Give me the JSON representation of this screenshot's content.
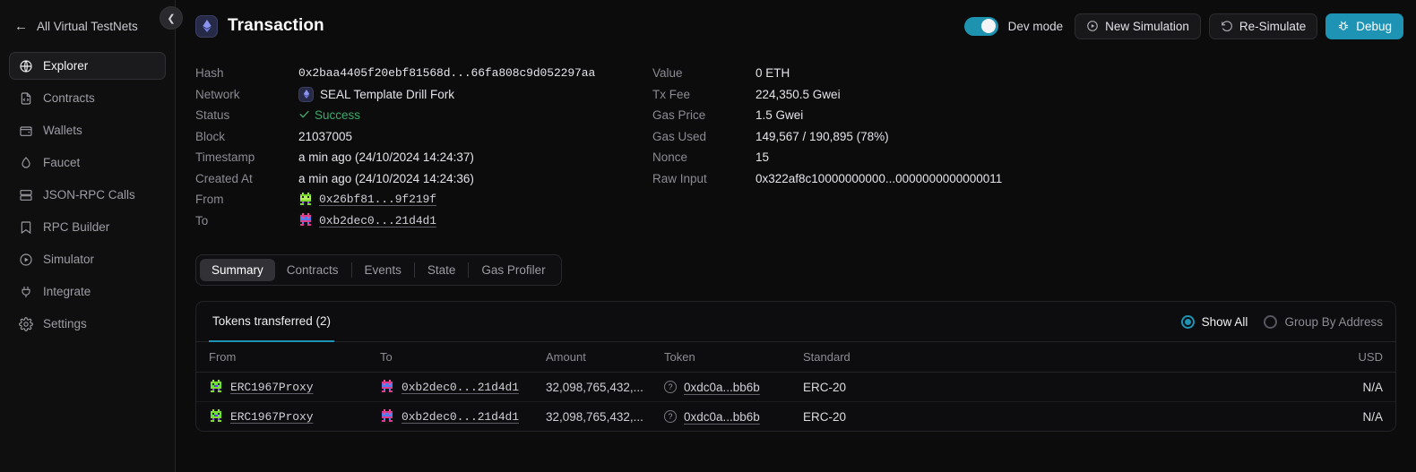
{
  "sidebar": {
    "back_label": "All Virtual TestNets",
    "collapse_icon": "chevron-left-icon",
    "items": [
      {
        "label": "Explorer",
        "icon": "globe-icon",
        "active": true
      },
      {
        "label": "Contracts",
        "icon": "file-code-icon",
        "active": false
      },
      {
        "label": "Wallets",
        "icon": "wallet-icon",
        "active": false
      },
      {
        "label": "Faucet",
        "icon": "droplet-icon",
        "active": false
      },
      {
        "label": "JSON-RPC Calls",
        "icon": "server-icon",
        "active": false
      },
      {
        "label": "RPC Builder",
        "icon": "bookmark-icon",
        "active": false
      },
      {
        "label": "Simulator",
        "icon": "play-circle-icon",
        "active": false
      },
      {
        "label": "Integrate",
        "icon": "plug-icon",
        "active": false
      },
      {
        "label": "Settings",
        "icon": "gear-icon",
        "active": false
      }
    ]
  },
  "header": {
    "title": "Transaction",
    "badge_icon": "ethereum-icon",
    "dev_mode_label": "Dev mode",
    "dev_mode_on": true,
    "new_simulation_label": "New Simulation",
    "new_simulation_icon": "play-circle-icon",
    "resimulate_label": "Re-Simulate",
    "resimulate_icon": "rotate-ccw-icon",
    "debug_label": "Debug",
    "debug_icon": "bug-icon"
  },
  "details": {
    "left": [
      {
        "label": "Hash",
        "value": "0x2baa4405f20ebf81568d...66fa808c9d052297aa",
        "kind": "mono"
      },
      {
        "label": "Network",
        "value": "SEAL Template Drill Fork",
        "kind": "network"
      },
      {
        "label": "Status",
        "value": "Success",
        "kind": "status"
      },
      {
        "label": "Block",
        "value": "21037005",
        "kind": "text"
      },
      {
        "label": "Timestamp",
        "value": "a min ago (24/10/2024 14:24:37)",
        "kind": "text"
      },
      {
        "label": "Created At",
        "value": "a min ago (24/10/2024 14:24:36)",
        "kind": "text"
      },
      {
        "label": "From",
        "value": "0x26bf81...9f219f",
        "kind": "address",
        "avatar": "identicon-green"
      },
      {
        "label": "To",
        "value": "0xb2dec0...21d4d1",
        "kind": "address",
        "avatar": "identicon-pink"
      }
    ],
    "right": [
      {
        "label": "Value",
        "value": "0 ETH"
      },
      {
        "label": "Tx Fee",
        "value": "224,350.5 Gwei"
      },
      {
        "label": "Gas Price",
        "value": "1.5 Gwei"
      },
      {
        "label": "Gas Used",
        "value": "149,567 / 190,895 (78%)"
      },
      {
        "label": "Nonce",
        "value": "15"
      },
      {
        "label": "Raw Input",
        "value": "0x322af8c10000000000...0000000000000011"
      }
    ]
  },
  "tabs": [
    {
      "label": "Summary",
      "active": true
    },
    {
      "label": "Contracts",
      "active": false
    },
    {
      "label": "Events",
      "active": false
    },
    {
      "label": "State",
      "active": false
    },
    {
      "label": "Gas Profiler",
      "active": false
    }
  ],
  "panel": {
    "tab_label": "Tokens transferred (2)",
    "radio_show_all": "Show All",
    "radio_group_by_address": "Group By Address",
    "selected_radio": "Show All",
    "columns": [
      "From",
      "To",
      "Amount",
      "Token",
      "Standard",
      "USD"
    ],
    "rows": [
      {
        "from": "ERC1967Proxy",
        "from_avatar": "identicon-green",
        "to": "0xb2dec0...21d4d1",
        "to_avatar": "identicon-pink",
        "amount": "32,098,765,432,...",
        "token": "0xdc0a...bb6b",
        "token_icon": "question-circle-icon",
        "standard": "ERC-20",
        "usd": "N/A"
      },
      {
        "from": "ERC1967Proxy",
        "from_avatar": "identicon-green",
        "to": "0xb2dec0...21d4d1",
        "to_avatar": "identicon-pink",
        "amount": "32,098,765,432,...",
        "token": "0xdc0a...bb6b",
        "token_icon": "question-circle-icon",
        "standard": "ERC-20",
        "usd": "N/A"
      }
    ]
  },
  "colors": {
    "accent": "#1e93b4",
    "success": "#3fa96b",
    "background": "#0c0c0d",
    "sidebar": "#0f0f10"
  }
}
